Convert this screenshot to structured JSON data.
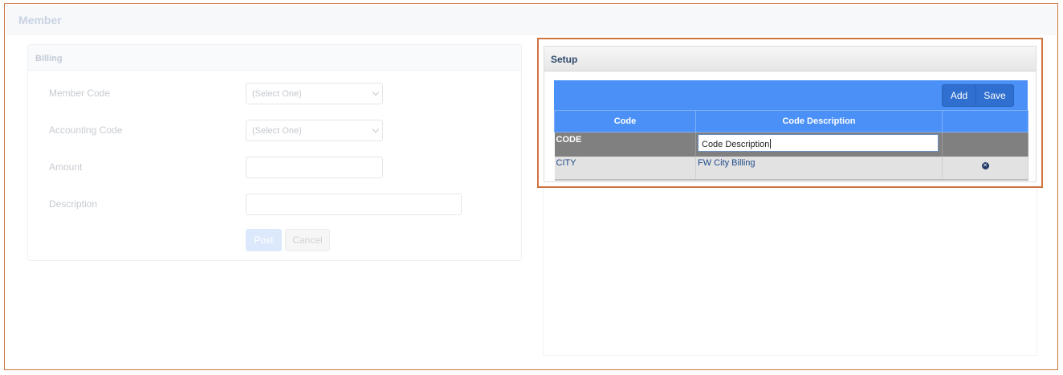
{
  "member": {
    "title": "Member"
  },
  "billing": {
    "title": "Billing",
    "fields": [
      {
        "label": "Member Code",
        "type": "select",
        "value": "(Select One)"
      },
      {
        "label": "Accounting Code",
        "type": "select",
        "value": "(Select One)"
      },
      {
        "label": "Amount",
        "type": "input",
        "value": ""
      },
      {
        "label": "Description",
        "type": "input",
        "value": ""
      }
    ],
    "post_label": "Post",
    "cancel_label": "Cancel"
  },
  "setup": {
    "title": "Setup",
    "add_label": "Add",
    "save_label": "Save",
    "columns": [
      "Code",
      "Code Description",
      ""
    ],
    "edit_row": {
      "code": "CODE",
      "description_value": "Code Description"
    },
    "rows": [
      {
        "code": "CITY",
        "description": "FW City Billing",
        "action_icon": "remove-circle-icon"
      }
    ],
    "remove_glyph": "✕"
  },
  "colors": {
    "accent": "#4a90f7",
    "highlight_border": "#d0733f",
    "edit_row_bg": "#808080",
    "data_row_bg": "#e2e2e2"
  }
}
